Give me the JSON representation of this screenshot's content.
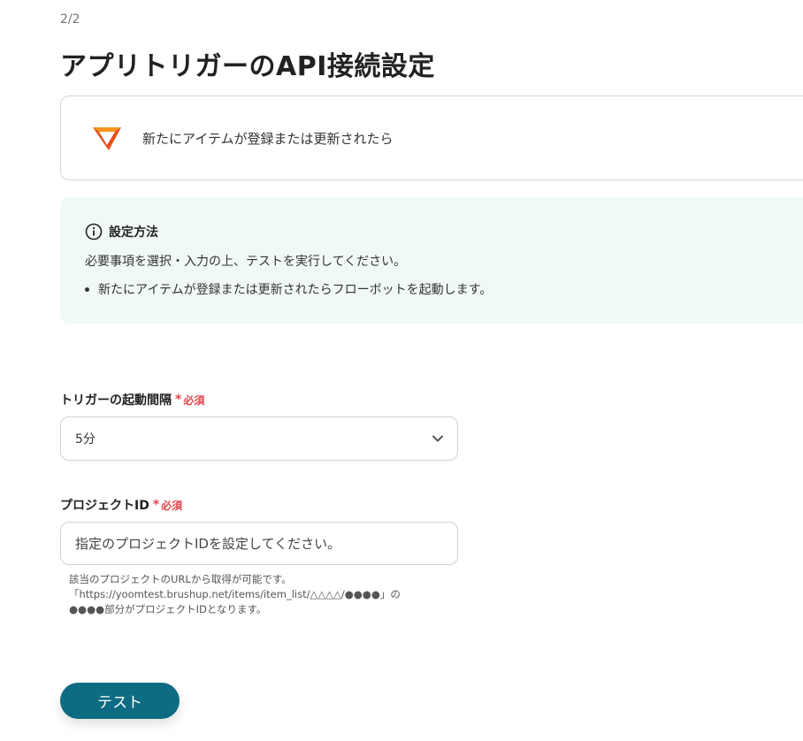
{
  "header": {
    "step": "2/2",
    "title": "アプリトリガーのAPI接続設定"
  },
  "app_card": {
    "text": "新たにアイテムが登録または更新されたら",
    "logo_icon": "brushup-logo-icon",
    "logo_colors": [
      "#f7941d",
      "#e8501d",
      "#c9341a"
    ]
  },
  "info": {
    "icon": "info-circle-icon",
    "heading": "設定方法",
    "line": "必要事項を選択・入力の上、テストを実行してください。",
    "bullets": [
      "新たにアイテムが登録または更新されたらフローボットを起動します。"
    ]
  },
  "fields": {
    "interval": {
      "label": "トリガーの起動間隔",
      "required_star": "*",
      "required_text": "必須",
      "value": "5分"
    },
    "project_id": {
      "label": "プロジェクトID",
      "required_star": "*",
      "required_text": "必須",
      "placeholder": "指定のプロジェクトIDを設定してください。",
      "value": "",
      "help": [
        "該当のプロジェクトのURLから取得が可能です。",
        "「https://yoomtest.brushup.net/items/item_list/△△△△/●●●●」の",
        "●●●●部分がプロジェクトIDとなります。"
      ]
    }
  },
  "actions": {
    "test_label": "テスト"
  },
  "colors": {
    "accent": "#0e6c82",
    "required": "#e0464b",
    "info_bg": "#f1f8f8"
  }
}
